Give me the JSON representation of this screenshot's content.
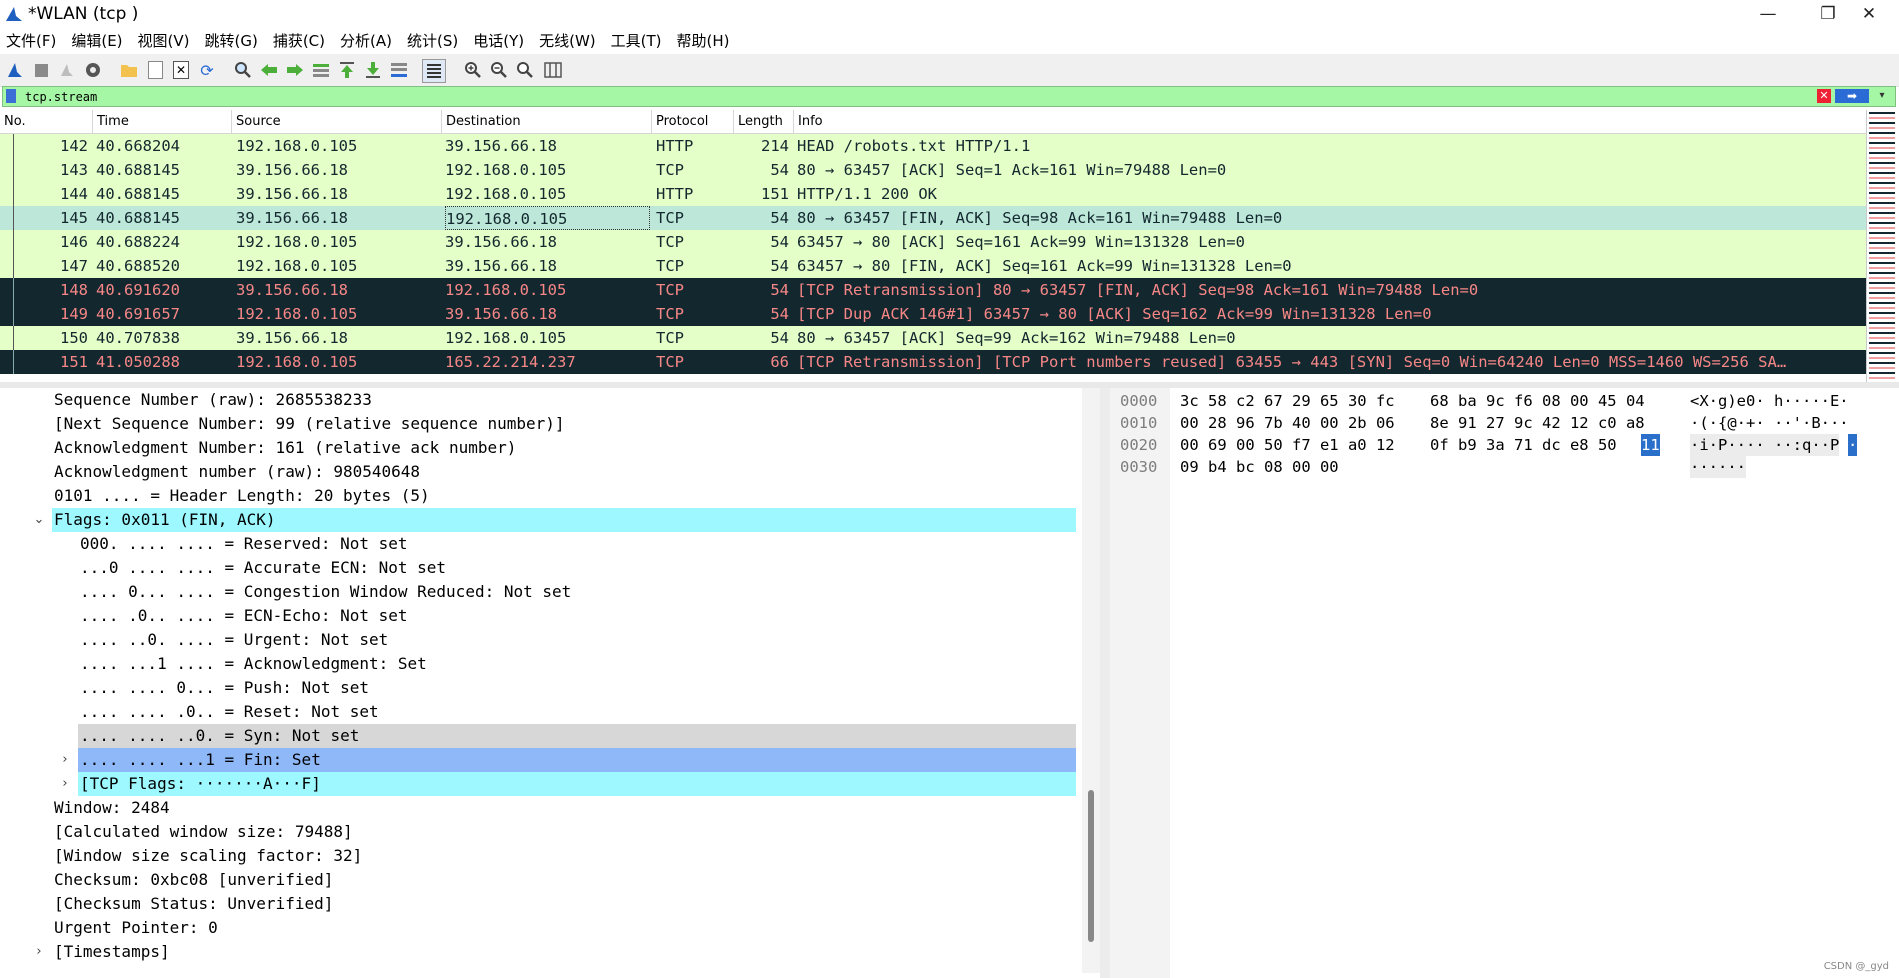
{
  "window": {
    "title": "*WLAN (tcp )",
    "controls": {
      "minimize": "—",
      "maximize": "❐",
      "close": "✕"
    }
  },
  "menu": [
    "文件(F)",
    "编辑(E)",
    "视图(V)",
    "跳转(G)",
    "捕获(C)",
    "分析(A)",
    "统计(S)",
    "电话(Y)",
    "无线(W)",
    "工具(T)",
    "帮助(H)"
  ],
  "toolbar": {
    "icons": [
      "shark-fin-start-icon",
      "stop-square-icon",
      "restart-icon",
      "capture-options-gear-icon",
      "open-folder-icon",
      "file-set-icon",
      "close-file-icon",
      "reload-icon",
      "find-magnifier-icon",
      "go-back-arrow-icon",
      "go-forward-arrow-icon",
      "go-to-packet-icon",
      "first-packet-icon",
      "last-packet-icon",
      "autoscroll-icon",
      "colorize-icon",
      "zoom-in-icon",
      "zoom-out-icon",
      "zoom-normal-icon",
      "resize-columns-icon"
    ]
  },
  "filter": {
    "value": "tcp.stream",
    "apply_label": "➡"
  },
  "packet_list": {
    "columns": [
      "No.",
      "Time",
      "Source",
      "Destination",
      "Protocol",
      "Length",
      "Info"
    ],
    "rows": [
      {
        "no": "142",
        "time": "40.668204",
        "src": "192.168.0.105",
        "dst": "39.156.66.18",
        "proto": "HTTP",
        "len": "214",
        "info": "HEAD /robots.txt HTTP/1.1",
        "style": "green"
      },
      {
        "no": "143",
        "time": "40.688145",
        "src": "39.156.66.18",
        "dst": "192.168.0.105",
        "proto": "TCP",
        "len": "54",
        "info": "80 → 63457 [ACK] Seq=1 Ack=161 Win=79488 Len=0",
        "style": "green"
      },
      {
        "no": "144",
        "time": "40.688145",
        "src": "39.156.66.18",
        "dst": "192.168.0.105",
        "proto": "HTTP",
        "len": "151",
        "info": "HTTP/1.1 200 OK",
        "style": "green"
      },
      {
        "no": "145",
        "time": "40.688145",
        "src": "39.156.66.18",
        "dst": "192.168.0.105",
        "proto": "TCP",
        "len": "54",
        "info": "80 → 63457 [FIN, ACK] Seq=98 Ack=161 Win=79488 Len=0",
        "style": "sel"
      },
      {
        "no": "146",
        "time": "40.688224",
        "src": "192.168.0.105",
        "dst": "39.156.66.18",
        "proto": "TCP",
        "len": "54",
        "info": "63457 → 80 [ACK] Seq=161 Ack=99 Win=131328 Len=0",
        "style": "green"
      },
      {
        "no": "147",
        "time": "40.688520",
        "src": "192.168.0.105",
        "dst": "39.156.66.18",
        "proto": "TCP",
        "len": "54",
        "info": "63457 → 80 [FIN, ACK] Seq=161 Ack=99 Win=131328 Len=0",
        "style": "green"
      },
      {
        "no": "148",
        "time": "40.691620",
        "src": "39.156.66.18",
        "dst": "192.168.0.105",
        "proto": "TCP",
        "len": "54",
        "info": "[TCP Retransmission] 80 → 63457 [FIN, ACK] Seq=98 Ack=161 Win=79488 Len=0",
        "style": "dark"
      },
      {
        "no": "149",
        "time": "40.691657",
        "src": "192.168.0.105",
        "dst": "39.156.66.18",
        "proto": "TCP",
        "len": "54",
        "info": "[TCP Dup ACK 146#1] 63457 → 80 [ACK] Seq=162 Ack=99 Win=131328 Len=0",
        "style": "dark"
      },
      {
        "no": "150",
        "time": "40.707838",
        "src": "39.156.66.18",
        "dst": "192.168.0.105",
        "proto": "TCP",
        "len": "54",
        "info": "80 → 63457 [ACK] Seq=99 Ack=162 Win=79488 Len=0",
        "style": "green"
      },
      {
        "no": "151",
        "time": "41.050288",
        "src": "192.168.0.105",
        "dst": "165.22.214.237",
        "proto": "TCP",
        "len": "66",
        "info": "[TCP Retransmission] [TCP Port numbers reused] 63455 → 443 [SYN] Seq=0 Win=64240 Len=0 MSS=1460 WS=256 SA…",
        "style": "dark"
      }
    ]
  },
  "detail_tree": [
    {
      "text": "Sequence Number (raw): 2685538233",
      "indent": 0,
      "expander": "",
      "hl": ""
    },
    {
      "text": "[Next Sequence Number: 99    (relative sequence number)]",
      "indent": 0,
      "expander": "",
      "hl": ""
    },
    {
      "text": "Acknowledgment Number: 161    (relative ack number)",
      "indent": 0,
      "expander": "",
      "hl": ""
    },
    {
      "text": "Acknowledgment number (raw): 980540648",
      "indent": 0,
      "expander": "",
      "hl": ""
    },
    {
      "text": "0101 .... = Header Length: 20 bytes (5)",
      "indent": 0,
      "expander": "",
      "hl": ""
    },
    {
      "text": "Flags: 0x011 (FIN, ACK)",
      "indent": 0,
      "expander": "⌄",
      "hl": "cyan"
    },
    {
      "text": "000. .... .... = Reserved: Not set",
      "indent": 1,
      "expander": "",
      "hl": ""
    },
    {
      "text": "...0 .... .... = Accurate ECN: Not set",
      "indent": 1,
      "expander": "",
      "hl": ""
    },
    {
      "text": ".... 0... .... = Congestion Window Reduced: Not set",
      "indent": 1,
      "expander": "",
      "hl": ""
    },
    {
      "text": ".... .0.. .... = ECN-Echo: Not set",
      "indent": 1,
      "expander": "",
      "hl": ""
    },
    {
      "text": ".... ..0. .... = Urgent: Not set",
      "indent": 1,
      "expander": "",
      "hl": ""
    },
    {
      "text": ".... ...1 .... = Acknowledgment: Set",
      "indent": 1,
      "expander": "",
      "hl": ""
    },
    {
      "text": ".... .... 0... = Push: Not set",
      "indent": 1,
      "expander": "",
      "hl": ""
    },
    {
      "text": ".... .... .0.. = Reset: Not set",
      "indent": 1,
      "expander": "",
      "hl": ""
    },
    {
      "text": ".... .... ..0. = Syn: Not set",
      "indent": 1,
      "expander": "",
      "hl": "grey"
    },
    {
      "text": ".... .... ...1 = Fin: Set",
      "indent": 1,
      "expander": "›",
      "hl": "blue"
    },
    {
      "text": "[TCP Flags: ·······A···F]",
      "indent": 1,
      "expander": "›",
      "hl": "cyan"
    },
    {
      "text": "Window: 2484",
      "indent": 0,
      "expander": "",
      "hl": ""
    },
    {
      "text": "[Calculated window size: 79488]",
      "indent": 0,
      "expander": "",
      "hl": ""
    },
    {
      "text": "[Window size scaling factor: 32]",
      "indent": 0,
      "expander": "",
      "hl": ""
    },
    {
      "text": "Checksum: 0xbc08 [unverified]",
      "indent": 0,
      "expander": "",
      "hl": ""
    },
    {
      "text": "[Checksum Status: Unverified]",
      "indent": 0,
      "expander": "",
      "hl": ""
    },
    {
      "text": "Urgent Pointer: 0",
      "indent": 0,
      "expander": "",
      "hl": ""
    },
    {
      "text": "[Timestamps]",
      "indent": 0,
      "expander": "›",
      "hl": ""
    }
  ],
  "bytes": [
    {
      "offset": "0000",
      "hex1": "3c 58 c2 67 29 65 30 fc",
      "hex2": "68 ba 9c f6 08 00 45 04",
      "hex_sel": "",
      "ascii": "<X·g)e0· h·····E·",
      "ascii_sel": "",
      "dim": false
    },
    {
      "offset": "0010",
      "hex1": "00 28 96 7b 40 00 2b 06",
      "hex2": "8e 91 27 9c 42 12 c0 a8",
      "hex_sel": "",
      "ascii": "·(·{@·+· ··'·B···",
      "ascii_sel": "",
      "dim": false
    },
    {
      "offset": "0020",
      "hex1": "00 69 00 50 f7 e1 a0 12",
      "hex2": "0f b9 3a 71 dc e8 50",
      "hex_sel": "11",
      "ascii": "·i·P···· ··:q··P",
      "ascii_sel": "·",
      "dim": true
    },
    {
      "offset": "0030",
      "hex1": "09 b4 bc 08 00 00",
      "hex2": "",
      "hex_sel": "",
      "ascii": "······",
      "ascii_sel": "",
      "dim": true
    }
  ],
  "watermark": "CSDN @_gyd"
}
